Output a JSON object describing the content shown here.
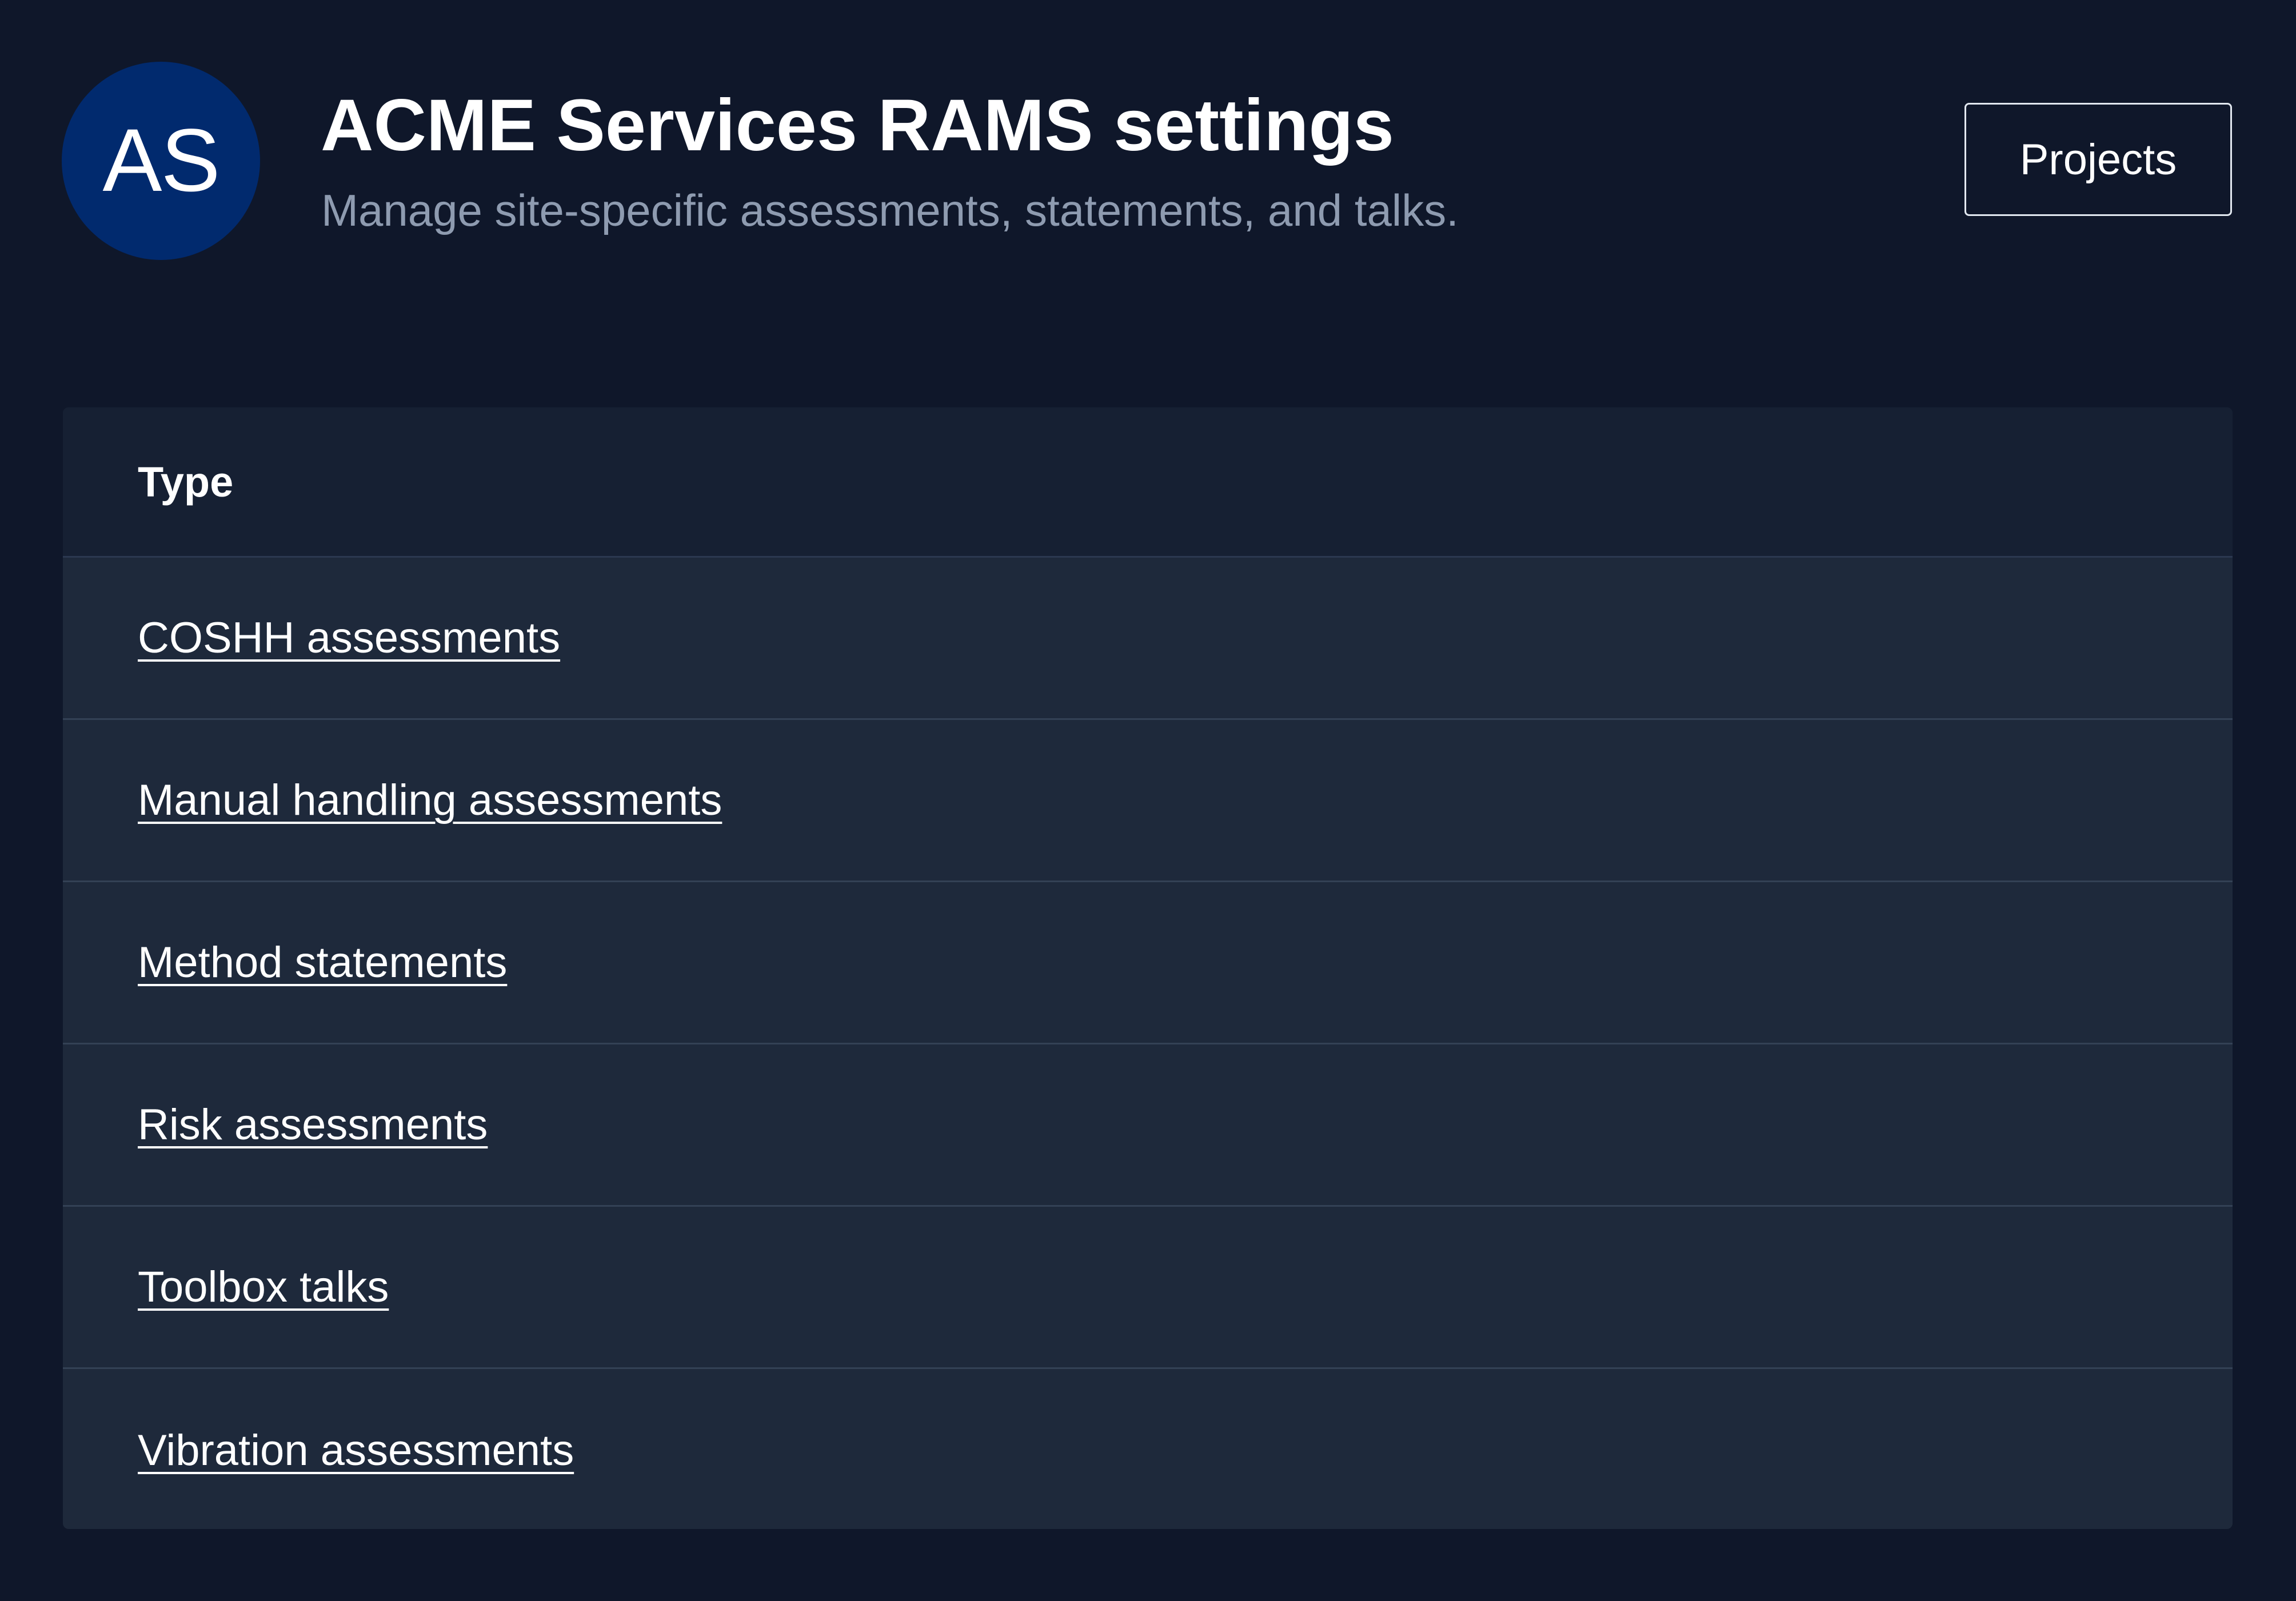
{
  "header": {
    "avatar_initials": "AS",
    "title": "ACME Services RAMS settings",
    "subtitle": "Manage site-specific assessments, statements, and talks.",
    "projects_button_label": "Projects"
  },
  "table": {
    "column_header": "Type",
    "rows": [
      {
        "label": "COSHH assessments"
      },
      {
        "label": "Manual handling assessments"
      },
      {
        "label": "Method statements"
      },
      {
        "label": "Risk assessments"
      },
      {
        "label": "Toolbox talks"
      },
      {
        "label": "Vibration assessments"
      }
    ]
  },
  "colors": {
    "background": "#0f172a",
    "avatar": "#012a6e",
    "table_row": "#1e293b",
    "table_header": "#162033",
    "subtitle_text": "#8e9bb0"
  }
}
